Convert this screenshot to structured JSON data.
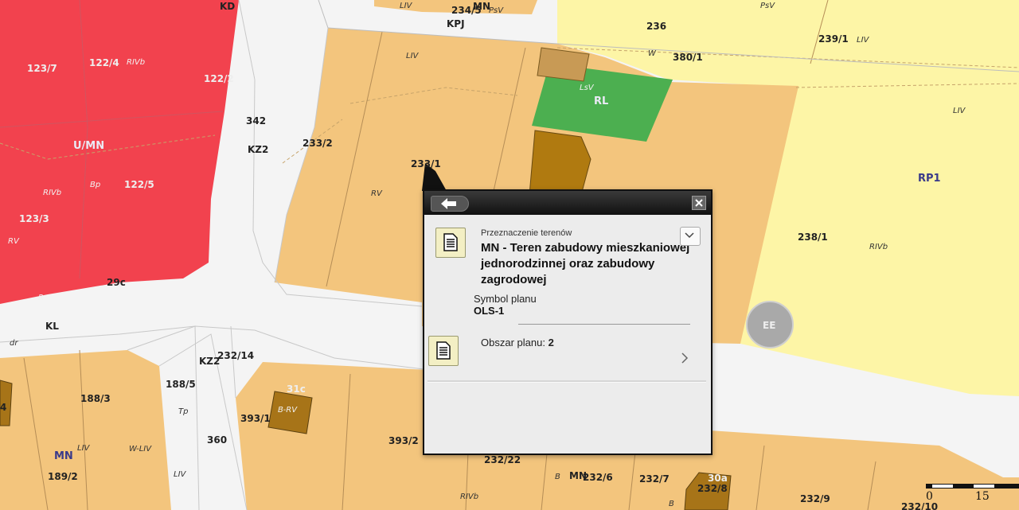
{
  "map": {
    "parcels": [
      {
        "id": "p1",
        "text": "KD"
      },
      {
        "id": "p2",
        "text": "123/7"
      },
      {
        "id": "p3",
        "text": "122/4"
      },
      {
        "id": "p4",
        "text": "122/2"
      },
      {
        "id": "p5",
        "text": "342"
      },
      {
        "id": "p6",
        "text": "KZ2"
      },
      {
        "id": "p7",
        "text": "U/MN"
      },
      {
        "id": "p8",
        "text": "122/5"
      },
      {
        "id": "p9",
        "text": "123/3"
      },
      {
        "id": "p10",
        "text": "233/2"
      },
      {
        "id": "p11",
        "text": "233/1"
      },
      {
        "id": "p12",
        "text": "234/5"
      },
      {
        "id": "p13",
        "text": "MN"
      },
      {
        "id": "p14",
        "text": "KPJ"
      },
      {
        "id": "p15",
        "text": "236"
      },
      {
        "id": "p16",
        "text": "380/1"
      },
      {
        "id": "p17",
        "text": "239/1"
      },
      {
        "id": "p18",
        "text": "RL"
      },
      {
        "id": "p19",
        "text": "RP1"
      },
      {
        "id": "p20",
        "text": "238/1"
      },
      {
        "id": "p21",
        "text": "EE"
      },
      {
        "id": "p22",
        "text": "KL"
      },
      {
        "id": "p23",
        "text": "29c"
      },
      {
        "id": "p24",
        "text": "232/14"
      },
      {
        "id": "p25",
        "text": "KZ2"
      },
      {
        "id": "p26",
        "text": "188/3"
      },
      {
        "id": "p27",
        "text": "188/5"
      },
      {
        "id": "p28",
        "text": "360"
      },
      {
        "id": "p29",
        "text": "MN"
      },
      {
        "id": "p30",
        "text": "189/2"
      },
      {
        "id": "p31",
        "text": "393/1"
      },
      {
        "id": "p32",
        "text": "31c"
      },
      {
        "id": "p33",
        "text": "B-RV"
      },
      {
        "id": "p34",
        "text": "393/2"
      },
      {
        "id": "p35",
        "text": "232/22"
      },
      {
        "id": "p36",
        "text": "MN"
      },
      {
        "id": "p37",
        "text": "232/6"
      },
      {
        "id": "p38",
        "text": "232/7"
      },
      {
        "id": "p39",
        "text": "30a"
      },
      {
        "id": "p40",
        "text": "232/8"
      },
      {
        "id": "p41",
        "text": "232/9"
      },
      {
        "id": "p42",
        "text": "232/10"
      },
      {
        "id": "p43",
        "text": "4"
      }
    ],
    "small_labels": [
      {
        "id": "s1",
        "text": "LIV"
      },
      {
        "id": "s2",
        "text": "PsV"
      },
      {
        "id": "s3",
        "text": "PsV"
      },
      {
        "id": "s4",
        "text": "LIV"
      },
      {
        "id": "s5",
        "text": "W"
      },
      {
        "id": "s6",
        "text": "LIV"
      },
      {
        "id": "s7",
        "text": "LsV"
      },
      {
        "id": "s8",
        "text": "RIVb"
      },
      {
        "id": "s9",
        "text": "RIVb"
      },
      {
        "id": "s10",
        "text": "Bp"
      },
      {
        "id": "s11",
        "text": "RV"
      },
      {
        "id": "s12",
        "text": "R"
      },
      {
        "id": "s13",
        "text": "RV"
      },
      {
        "id": "s14",
        "text": "LIV"
      },
      {
        "id": "s15",
        "text": "RIVb"
      },
      {
        "id": "s16",
        "text": "dr"
      },
      {
        "id": "s17",
        "text": "Tp"
      },
      {
        "id": "s18",
        "text": "LIV"
      },
      {
        "id": "s19",
        "text": "W-LIV"
      },
      {
        "id": "s20",
        "text": "LIV"
      },
      {
        "id": "s21",
        "text": "RIVb"
      },
      {
        "id": "s22",
        "text": "B"
      },
      {
        "id": "s23",
        "text": "B"
      }
    ],
    "scale": {
      "left": "0",
      "right": "15"
    }
  },
  "popup": {
    "category_label": "Przeznaczenie terenów",
    "zone_title": "MN - Teren zabudowy mieszkaniowej jednorodzinnej oraz zabudowy zagrodowej",
    "symbol_label": "Symbol planu",
    "symbol_value": "OLS-1",
    "area_label": "Obszar planu:",
    "area_value": "2"
  }
}
